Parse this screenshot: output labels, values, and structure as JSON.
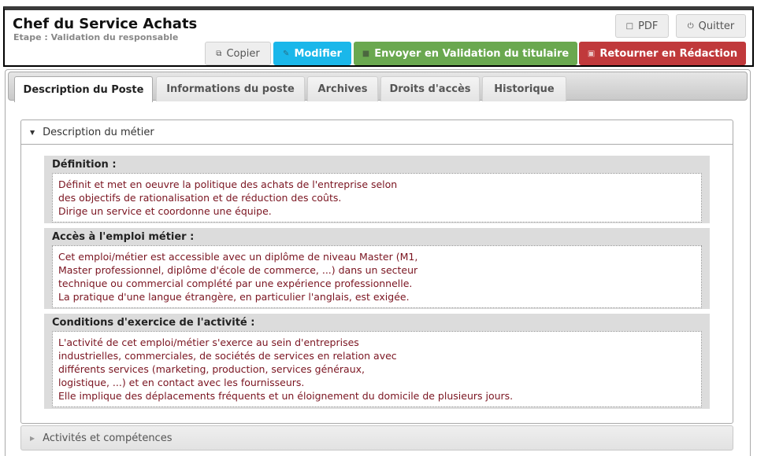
{
  "header": {
    "title": "Chef du Service Achats",
    "subtitle": "Etape : Validation du responsable",
    "buttons": {
      "pdf": {
        "label": "PDF",
        "icon": "file-icon"
      },
      "quitter": {
        "label": "Quitter",
        "icon": "power-icon"
      },
      "copier": {
        "label": "Copier",
        "icon": "copy-icon"
      },
      "modifier": {
        "label": "Modifier",
        "icon": "pencil-icon"
      },
      "envoyer": {
        "label": "Envoyer en Validation du titulaire",
        "icon": "stop-icon"
      },
      "retourner": {
        "label": "Retourner en Rédaction",
        "icon": "save-icon"
      }
    }
  },
  "tabs": [
    {
      "label": "Description du Poste",
      "active": true
    },
    {
      "label": "Informations du poste",
      "active": false
    },
    {
      "label": "Archives",
      "active": false
    },
    {
      "label": "Droits d'accès",
      "active": false
    },
    {
      "label": "Historique",
      "active": false
    }
  ],
  "accordion": [
    {
      "title": "Description du métier",
      "expanded": true,
      "fields": [
        {
          "label": "Définition :",
          "value": "Définit et met en oeuvre la politique des achats de l'entreprise selon\ndes objectifs de rationalisation et de réduction des coûts.\nDirige un service et coordonne une équipe."
        },
        {
          "label": "Accès à l'emploi métier :",
          "value": "Cet emploi/métier est accessible avec un diplôme de niveau Master (M1,\nMaster professionnel, diplôme d'école de commerce, ...) dans un secteur\ntechnique ou commercial complété par une expérience professionnelle.\nLa pratique d'une langue étrangère, en particulier l'anglais, est exigée."
        },
        {
          "label": "Conditions d'exercice de l'activité :",
          "value": "L'activité de cet emploi/métier s'exerce au sein d'entreprises\nindustrielles, commerciales, de sociétés de services en relation avec\ndifférents services (marketing, production, services généraux,\nlogistique, ...) et en contact avec les fournisseurs.\nElle implique des déplacements fréquents et un éloignement du domicile de plusieurs jours."
        }
      ]
    },
    {
      "title": "Activités et compétences",
      "expanded": false
    }
  ],
  "colors": {
    "info": "#1ab7ea",
    "success": "#6aa84f",
    "danger": "#c0393b",
    "field_text": "#7a1420"
  }
}
